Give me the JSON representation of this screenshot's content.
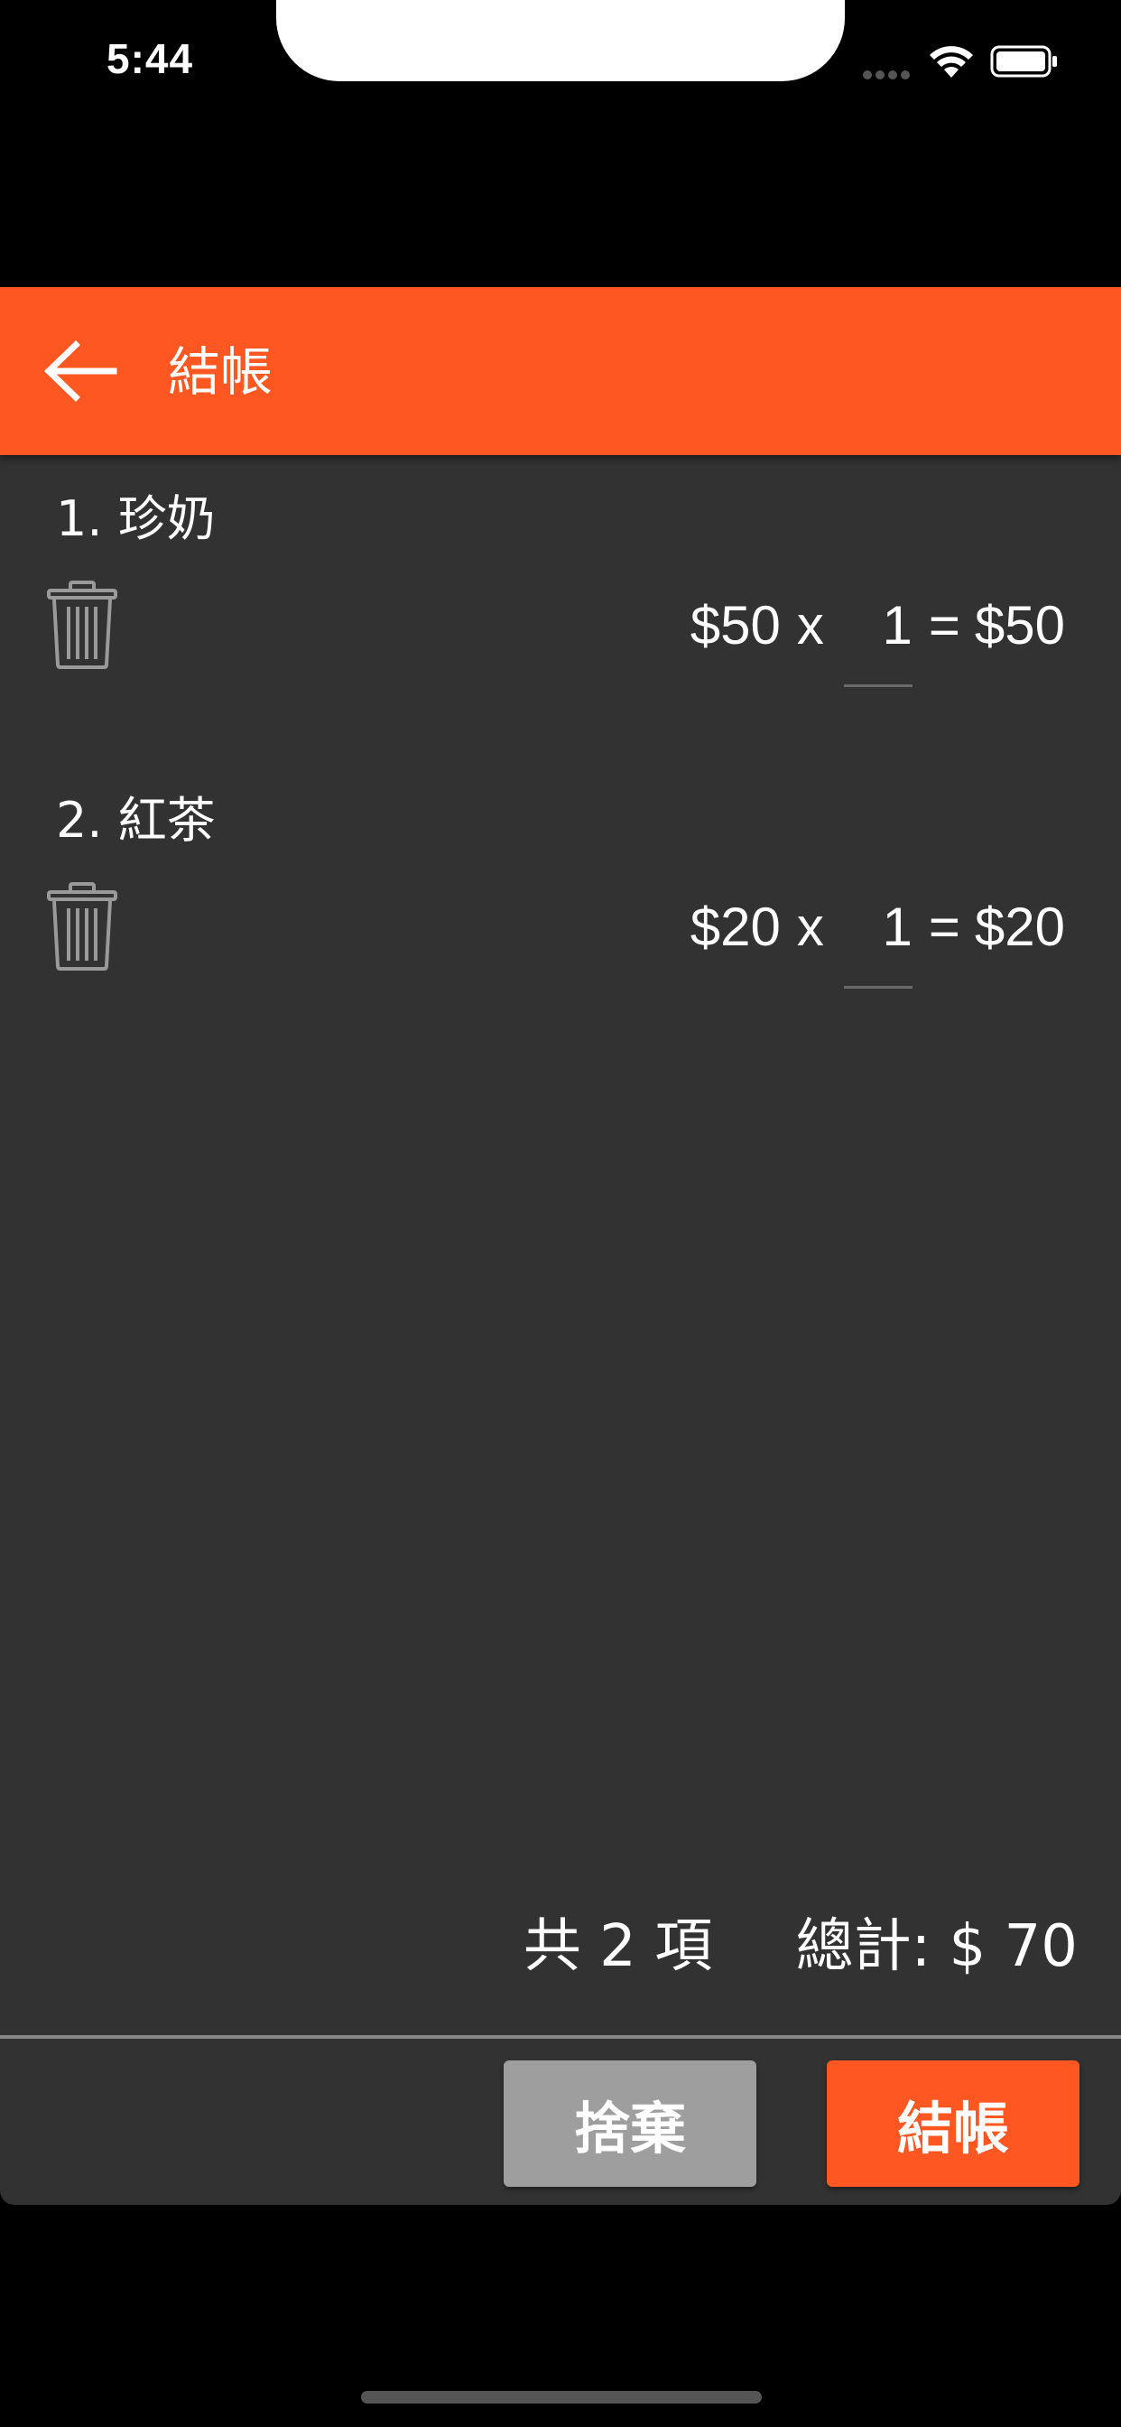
{
  "status_bar": {
    "time": "5:44"
  },
  "app_bar": {
    "title": "結帳",
    "back_icon": "arrow-left-icon",
    "color": "#ff5722"
  },
  "cart": {
    "items": [
      {
        "name": "1. 珍奶",
        "unit_price": "$50",
        "times": "x",
        "quantity": "1",
        "equals": "=",
        "subtotal": "$50",
        "delete_icon": "trash-icon"
      },
      {
        "name": "2. 紅茶",
        "unit_price": "$20",
        "times": "x",
        "quantity": "1",
        "equals": "=",
        "subtotal": "$20",
        "delete_icon": "trash-icon"
      }
    ]
  },
  "summary": {
    "count_text": "共 2 項",
    "total_text": "總計: $ 70"
  },
  "actions": {
    "discard_label": "捨棄",
    "checkout_label": "結帳",
    "discard_color": "#9e9e9e",
    "checkout_color": "#ff5722"
  }
}
